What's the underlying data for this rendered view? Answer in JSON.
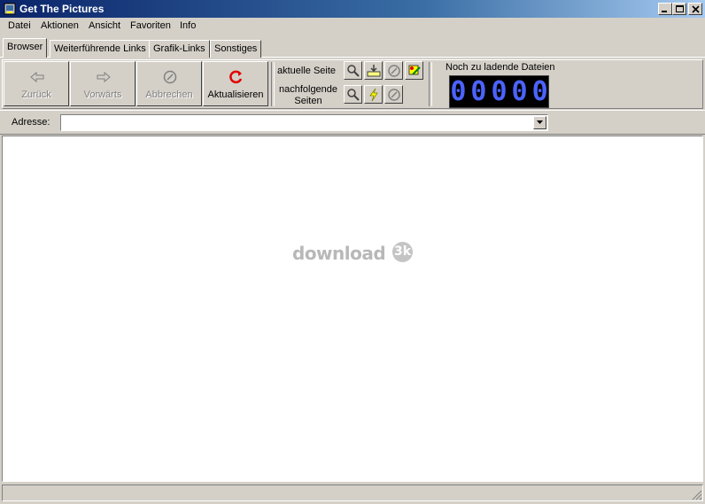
{
  "window": {
    "title": "Get The Pictures"
  },
  "menu": [
    "Datei",
    "Aktionen",
    "Ansicht",
    "Favoriten",
    "Info"
  ],
  "tabs": [
    "Browser",
    "Weiterführende Links",
    "Grafik-Links",
    "Sonstiges"
  ],
  "toolbar": {
    "back_label": "Zurück",
    "forward_label": "Vorwärts",
    "stop_label": "Abbrechen",
    "refresh_label": "Aktualisieren",
    "current_page_label": "aktuelle Seite",
    "next_pages_label_1": "nachfolgende",
    "next_pages_label_2": "Seiten",
    "remaining_files_label": "Noch zu ladende Dateien",
    "counter_digits": [
      "0",
      "0",
      "0",
      "0",
      "0"
    ]
  },
  "address": {
    "label": "Adresse:",
    "value": ""
  },
  "watermark": {
    "text": "download",
    "badge": "3k"
  },
  "colors": {
    "titlebar": "#0a246a",
    "counter_digits": "#4b63ff",
    "refresh_icon": "#e00000"
  }
}
